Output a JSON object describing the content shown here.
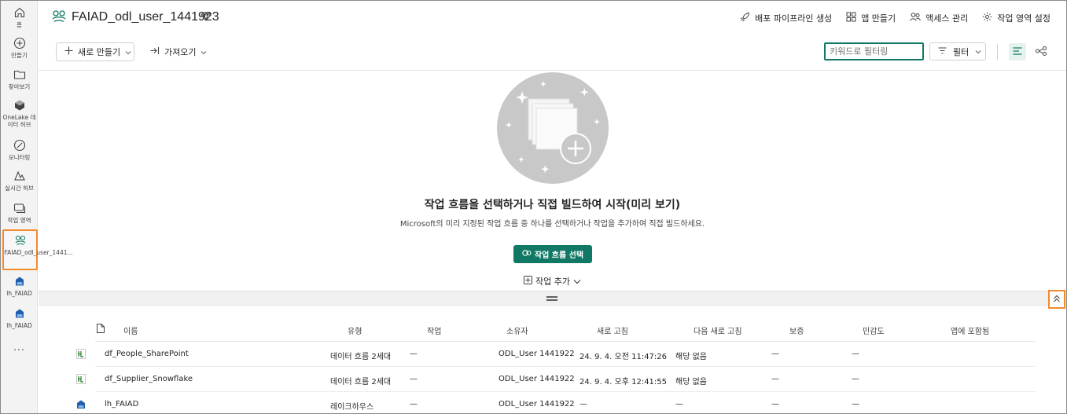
{
  "rail": {
    "items": [
      {
        "label": "홈",
        "icon": "home-icon"
      },
      {
        "label": "만들기",
        "icon": "create-icon"
      },
      {
        "label": "찾아보기",
        "icon": "folder-icon"
      },
      {
        "label": "OneLake 데이터 허브",
        "icon": "onelake-icon"
      },
      {
        "label": "모니터링",
        "icon": "monitor-icon"
      },
      {
        "label": "실시간 허브",
        "icon": "realtime-icon"
      },
      {
        "label": "작업 영역",
        "icon": "workspaces-icon"
      },
      {
        "label": "FAIAD_odl_user_1441...",
        "icon": "workspace-icon"
      },
      {
        "label": "lh_FAIAD",
        "icon": "lakehouse-icon"
      },
      {
        "label": "lh_FAIAD",
        "icon": "lakehouse-icon"
      }
    ],
    "more": "..."
  },
  "header": {
    "title": "FAIAD_odl_user_1441923",
    "actions": {
      "deploy": "배포 파이프라인 생성",
      "app": "앱 만들기",
      "access": "액세스 관리",
      "settings": "작업 영역 설정"
    }
  },
  "toolbar": {
    "new_label": "새로 만들기",
    "import_label": "가져오기",
    "search_placeholder": "키워드로 필터링",
    "filter_label": "필터"
  },
  "empty_state": {
    "title": "작업 흐름을 선택하거나 직접 빌드하여 시작(미리 보기)",
    "subtitle": "Microsoft의 미리 지정된 작업 흐름 중 하나를 선택하거나 작업을 추가하여 직접 빌드하세요.",
    "primary_button": "작업 흐름 선택",
    "add_task": "작업 추가"
  },
  "table": {
    "columns": [
      "이름",
      "유형",
      "작업",
      "소유자",
      "새로 고침",
      "다음 새로 고침",
      "보증",
      "민감도",
      "앱에 포함됨"
    ],
    "rows": [
      {
        "name": "df_People_SharePoint",
        "type": "데이터 흐름 2세대",
        "task": "—",
        "owner": "ODL_User 1441922",
        "refreshed": "24. 9. 4. 오전 11:47:26",
        "next": "해당 없음",
        "endorsement": "—",
        "sensitivity": "—",
        "icon": "dataflow-icon"
      },
      {
        "name": "df_Supplier_Snowflake",
        "type": "데이터 흐름 2세대",
        "task": "—",
        "owner": "ODL_User 1441922",
        "refreshed": "24. 9. 4. 오후 12:41:55",
        "next": "해당 없음",
        "endorsement": "—",
        "sensitivity": "—",
        "icon": "dataflow-icon"
      },
      {
        "name": "lh_FAIAD",
        "type": "레이크하우스",
        "task": "—",
        "owner": "ODL_User 1441922",
        "refreshed": "—",
        "next": "—",
        "endorsement": "—",
        "sensitivity": "—",
        "icon": "lakehouse-icon"
      }
    ]
  },
  "colors": {
    "accent": "#117865",
    "highlight": "#f28a2e",
    "rail_bg": "#f3f3f3"
  }
}
